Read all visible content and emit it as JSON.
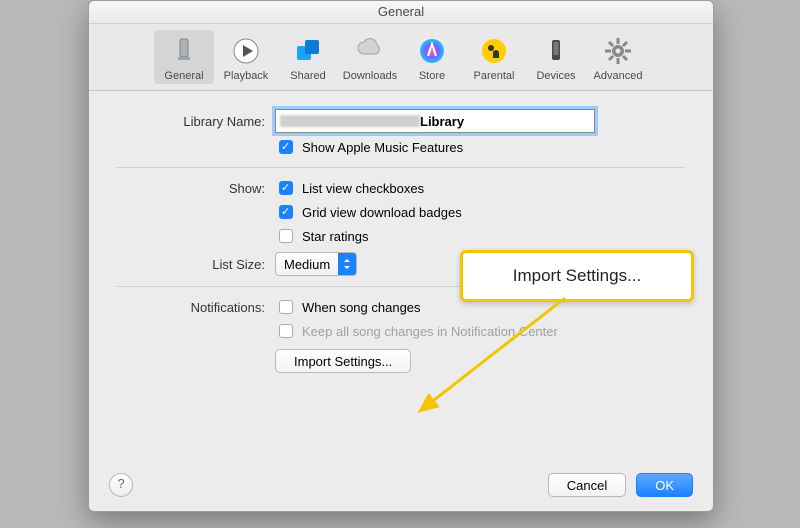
{
  "window": {
    "title": "General"
  },
  "toolbar": {
    "items": [
      {
        "label": "General"
      },
      {
        "label": "Playback"
      },
      {
        "label": "Shared"
      },
      {
        "label": "Downloads"
      },
      {
        "label": "Store"
      },
      {
        "label": "Parental"
      },
      {
        "label": "Devices"
      },
      {
        "label": "Advanced"
      }
    ]
  },
  "labels": {
    "library_name": "Library Name:",
    "show": "Show:",
    "list_size": "List Size:",
    "notifications": "Notifications:"
  },
  "library_name_value": "Library",
  "checks": {
    "show_apple_music": "Show Apple Music Features",
    "list_view_checkboxes": "List view checkboxes",
    "grid_view_badges": "Grid view download badges",
    "star_ratings": "Star ratings",
    "when_song_changes": "When song changes",
    "keep_in_nc": "Keep all song changes in Notification Center"
  },
  "list_size_value": "Medium",
  "buttons": {
    "import_settings": "Import Settings...",
    "cancel": "Cancel",
    "ok": "OK"
  },
  "callout": "Import Settings..."
}
